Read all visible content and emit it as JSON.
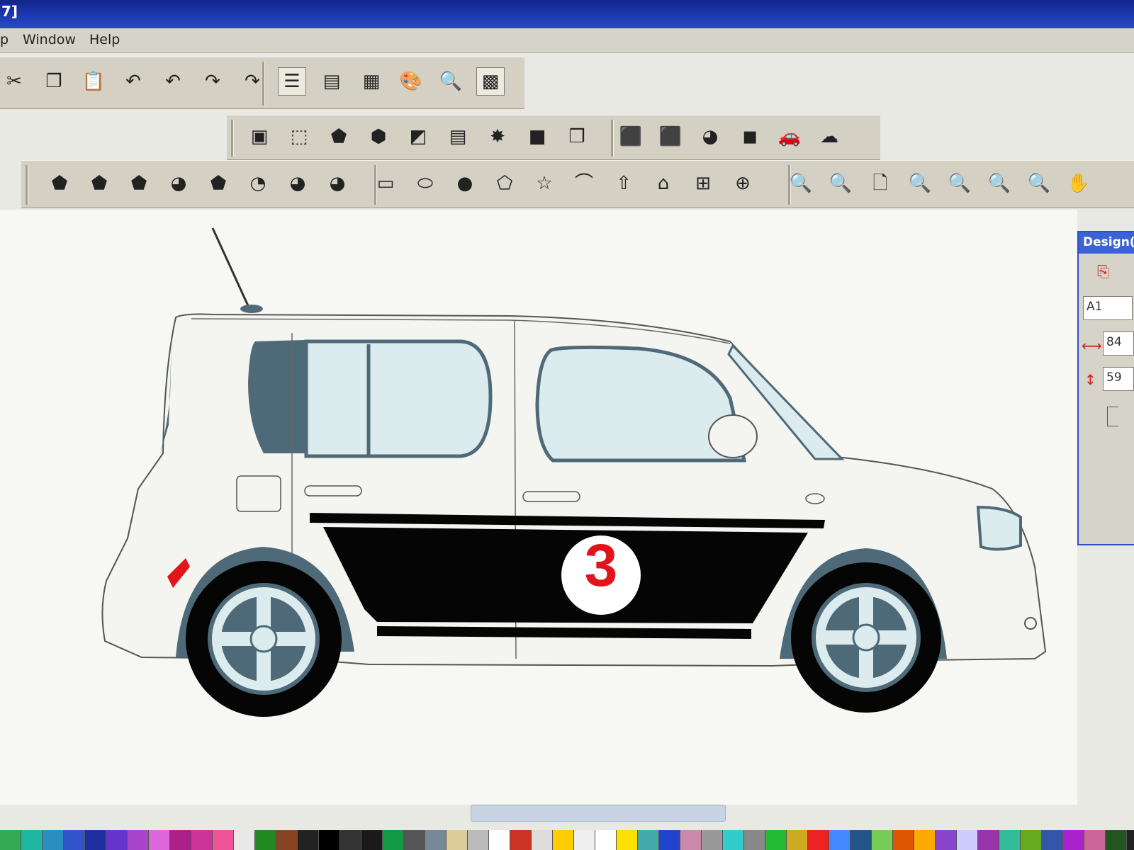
{
  "window": {
    "title_fragment": "7]"
  },
  "menu": {
    "cut_off_item": "p",
    "items": [
      "Window",
      "Help"
    ]
  },
  "toolbar1": {
    "buttons": [
      "cut-icon",
      "copy-icon",
      "paste-icon",
      "undo-icon",
      "undo-multiple-icon",
      "redo-icon",
      "redo-multiple-icon",
      "object-properties-icon",
      "layer-list-icon",
      "print-preview-icon",
      "color-palette-icon",
      "fill-inspector-icon",
      "color-grid-icon"
    ],
    "glyphs": [
      "✂",
      "❐",
      "📋",
      "↶",
      "↶",
      "↷",
      "↷",
      "☰",
      "▤",
      "▦",
      "🎨",
      "🔍",
      "▩"
    ],
    "active": [
      "object-properties-icon",
      "color-grid-icon"
    ]
  },
  "toolbar2": {
    "buttons": [
      "select-frame-icon",
      "dashed-select-icon",
      "weld-shape-icon",
      "shape-solid-icon",
      "combine-shapes-icon",
      "hatch-fill-icon",
      "star-burst-icon",
      "bevel-shape-icon",
      "3d-box-icon",
      "node-select-icon",
      "node-edit-icon",
      "contour-shape-icon",
      "shadow-shape-icon",
      "vehicle-template-icon",
      "cloud-shape-icon"
    ],
    "glyphs": [
      "▣",
      "⬚",
      "⬟",
      "⬢",
      "◩",
      "▤",
      "✸",
      "■",
      "❒",
      "⬛",
      "⬛",
      "◕",
      "◼",
      "🚗",
      "☁"
    ]
  },
  "toolbar3": {
    "buttons": [
      "blend-shape-1-icon",
      "blend-shape-2-icon",
      "blend-shape-3-icon",
      "blend-shape-4-icon",
      "blend-shape-5-icon",
      "blend-shape-6-icon",
      "blend-shape-7-icon",
      "blend-shape-8-icon",
      "rectangle-tool-icon",
      "ellipse-tool-icon",
      "circle-tool-icon",
      "pentagon-tool-icon",
      "star-tool-icon",
      "arc-tool-icon",
      "arrow-tool-icon",
      "house-tool-icon",
      "dimension-tool-icon",
      "crosshair-tool-icon",
      "zoom-fit-icon",
      "zoom-in-icon",
      "zoom-page-icon",
      "zoom-out-icon",
      "zoom-selection-icon",
      "zoom-previous-icon",
      "zoom-color-icon",
      "pan-hand-icon"
    ],
    "glyphs": [
      "⬟",
      "⬟",
      "⬟",
      "◕",
      "⬟",
      "◔",
      "◕",
      "◕",
      "▭",
      "⬭",
      "●",
      "⬠",
      "☆",
      "⌒",
      "⇧",
      "⌂",
      "⊞",
      "⊕",
      "🔍",
      "🔍",
      "🗋",
      "🔍",
      "🔍",
      "🔍",
      "🔍",
      "✋"
    ]
  },
  "design_panel": {
    "title": "Design(",
    "field_label": "A1",
    "width_value": "84",
    "height_value": "59"
  },
  "artwork": {
    "race_number": "3",
    "number_color": "#e1141c",
    "stripe_color": "#050505",
    "trim_color": "#4e6a78",
    "glass_color": "#dcecee"
  },
  "palette": [
    "#33aa55",
    "#1fb6a0",
    "#2a8fc0",
    "#3355cc",
    "#1e2fa0",
    "#6633cc",
    "#aa44cc",
    "#dd66dd",
    "#aa2288",
    "#cc3399",
    "#ee5599",
    "#e8e8e8",
    "#228822",
    "#884422",
    "#222222",
    "#000000",
    "#333333",
    "#1a1a1a",
    "#119944",
    "#555555",
    "#778899",
    "#ddcc99",
    "#bbbbbb",
    "#ffffff",
    "#cc3322",
    "#dddddd",
    "#ffcc00",
    "#eeeeee",
    "#ffffff",
    "#ffe000",
    "#44aaaa",
    "#2244cc",
    "#cc88aa",
    "#999999",
    "#33cccc",
    "#888888",
    "#22bb33",
    "#ccaa22",
    "#ee2222",
    "#4488ff",
    "#225588",
    "#77cc55",
    "#dd5500",
    "#ffaa00",
    "#8844cc",
    "#ccccff",
    "#9933aa",
    "#33bb99",
    "#66aa22",
    "#3355aa",
    "#aa22cc",
    "#cc6699",
    "#225522"
  ]
}
